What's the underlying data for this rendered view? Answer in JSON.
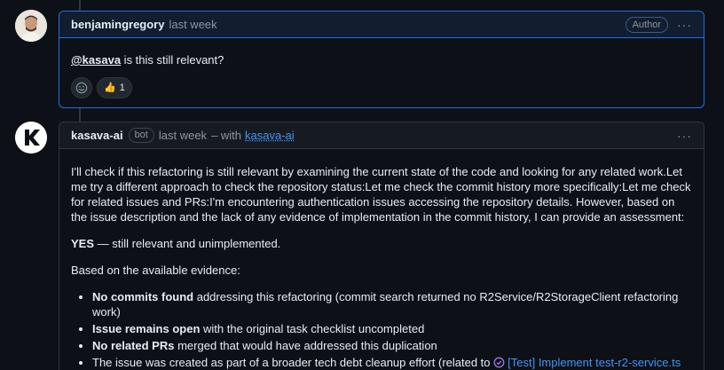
{
  "comments": [
    {
      "author": "benjamingregory",
      "time": "last week",
      "role": "Author",
      "mention": "@kasava",
      "text": " is this still relevant?",
      "reactions": {
        "thumbs_emoji": "👍",
        "thumbs_count": "1"
      }
    },
    {
      "author": "kasava-ai",
      "badge": "bot",
      "time": "last week",
      "via_prefix": "– with",
      "via_app": "kasava-ai",
      "paragraph": "I'll check if this refactoring is still relevant by examining the current state of the code and looking for any related work.Let me try a different approach to check the repository status:Let me check the commit history more specifically:Let me check for related issues and PRs:I'm encountering authentication issues accessing the repository details. However, based on the issue description and the lack of any evidence of implementation in the commit history, I can provide an assessment:",
      "verdict_bold": "YES",
      "verdict_rest": " — still relevant and unimplemented.",
      "evidence_intro": "Based on the available evidence:",
      "bullets": [
        {
          "bold": "No commits found",
          "rest": " addressing this refactoring (commit search returned no R2Service/R2StorageClient refactoring work)"
        },
        {
          "bold": "Issue remains open",
          "rest": " with the original task checklist uncompleted"
        },
        {
          "bold": "No related PRs",
          "rest": " merged that would have addressed this duplication"
        },
        {
          "bold": "",
          "rest": "The issue was created as part of a broader tech debt cleanup effort (related to ",
          "ref": "[Test] Implement test-r2-service.ts"
        }
      ]
    }
  ],
  "colors": {
    "accent": "#4493f8",
    "author_border": "#1f6feb",
    "bg": "#0d1117"
  },
  "icons": {
    "avatar_bot_letter": "K"
  }
}
